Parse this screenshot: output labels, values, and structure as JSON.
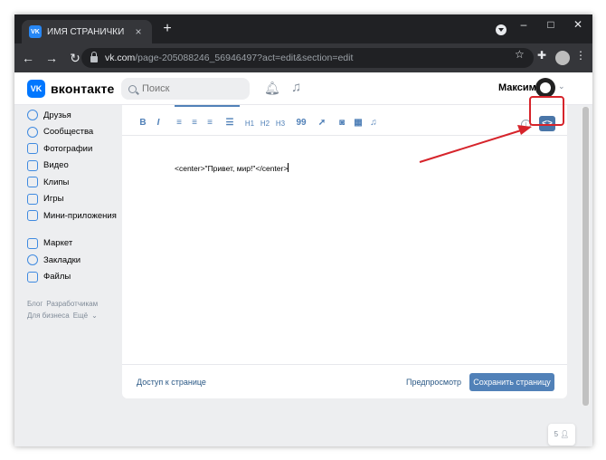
{
  "browser": {
    "tab_title": "ИМЯ СТРАНИЧКИ",
    "tab_favicon": "VK",
    "url_host": "vk.com",
    "url_path": "/page-205088246_56946497?act=edit&section=edit"
  },
  "header": {
    "brand": "вконтакте",
    "search_placeholder": "Поиск",
    "user_name": "Максим"
  },
  "sidebar": {
    "items": [
      "Друзья",
      "Сообщества",
      "Фотографии",
      "Видео",
      "Клипы",
      "Игры",
      "Мини-приложения"
    ],
    "items2": [
      "Маркет",
      "Закладки",
      "Файлы"
    ],
    "links": [
      "Блог",
      "Разработчикам",
      "Для бизнеса",
      "Ещё"
    ]
  },
  "editor": {
    "toolbar": {
      "bold": "B",
      "italic": "I",
      "h1": "H1",
      "h2": "H2",
      "h3": "H3",
      "quote": "99",
      "code": "<>"
    },
    "content": "<center>\"Привет, мир!\"</center>",
    "footer": {
      "access": "Доступ к странице",
      "preview": "Предпросмотр",
      "save": "Сохранить страницу"
    }
  },
  "colors": {
    "accent": "#5181b8",
    "highlight": "#d6242b"
  },
  "corner_badge": "5"
}
